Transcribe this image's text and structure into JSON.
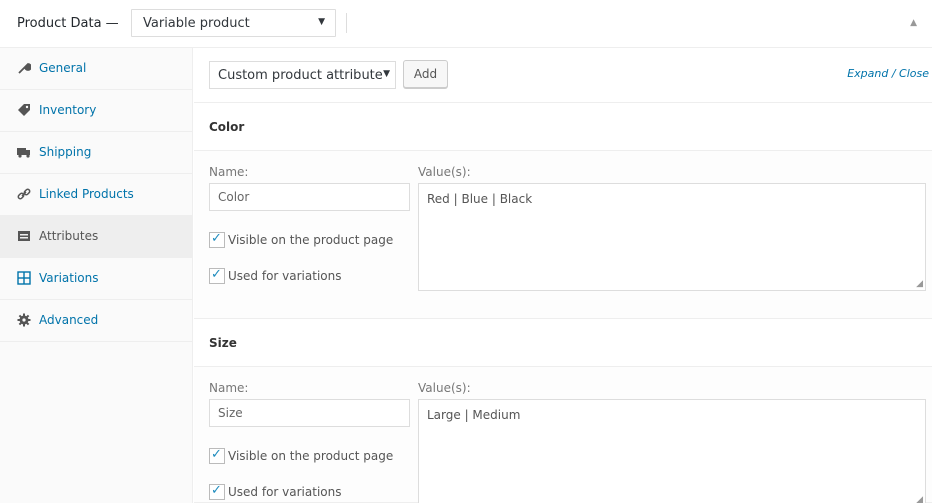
{
  "header": {
    "title": "Product Data —",
    "product_type": "Variable product"
  },
  "sidebar": {
    "items": [
      {
        "label": "General",
        "icon": "wrench-icon"
      },
      {
        "label": "Inventory",
        "icon": "tag-icon"
      },
      {
        "label": "Shipping",
        "icon": "truck-icon"
      },
      {
        "label": "Linked Products",
        "icon": "link-icon"
      },
      {
        "label": "Attributes",
        "icon": "list-icon",
        "active": true
      },
      {
        "label": "Variations",
        "icon": "grid-icon"
      },
      {
        "label": "Advanced",
        "icon": "gear-icon"
      }
    ]
  },
  "toolbar": {
    "attribute_select": "Custom product attribute",
    "add_label": "Add",
    "expand_close": "Expand / Close"
  },
  "attributes": [
    {
      "heading": "Color",
      "name_label": "Name:",
      "name_value": "Color",
      "values_label": "Value(s):",
      "values": "Red | Blue | Black",
      "visible_label": "Visible on the product page",
      "visible_checked": true,
      "variations_label": "Used for variations",
      "variations_checked": true
    },
    {
      "heading": "Size",
      "name_label": "Name:",
      "name_value": "Size",
      "values_label": "Value(s):",
      "values": "Large | Medium",
      "visible_label": "Visible on the product page",
      "visible_checked": true,
      "variations_label": "Used for variations",
      "variations_checked": true
    }
  ],
  "colors": {
    "link": "#0073aa",
    "active_nav_bg": "#eeeeee",
    "border": "#dddddd"
  }
}
